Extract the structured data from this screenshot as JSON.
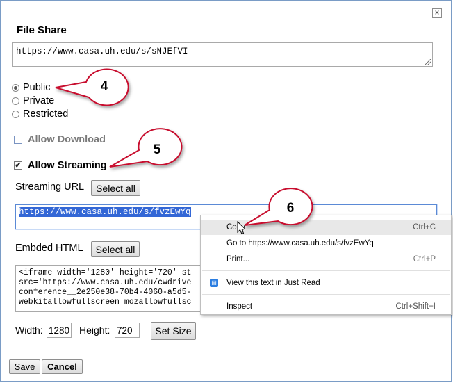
{
  "dialog": {
    "title": "File Share",
    "close_glyph": "×",
    "share_url": "https://www.casa.uh.edu/s/sNJEfVI"
  },
  "access": {
    "options": [
      {
        "label": "Public",
        "checked": true
      },
      {
        "label": "Private",
        "checked": false
      },
      {
        "label": "Restricted",
        "checked": false
      }
    ]
  },
  "permissions": {
    "allow_download": {
      "label": "Allow Download",
      "checked": false
    },
    "allow_streaming": {
      "label": "Allow Streaming",
      "checked": true
    }
  },
  "streaming": {
    "label": "Streaming URL",
    "select_all": "Select all",
    "url": "https://www.casa.uh.edu/s/fvzEwYq"
  },
  "embed": {
    "label": "Embded HTML",
    "select_all": "Select all",
    "code": "<iframe width='1280' height='720' st\nsrc='https://www.casa.uh.edu/cwdrive\nconference__2e250e38-70b4-4060-a5d5-\nwebkitallowfullscreen mozallowfullsc"
  },
  "size": {
    "width_label": "Width:",
    "width_value": "1280",
    "height_label": "Height:",
    "height_value": "720",
    "set_size": "Set Size"
  },
  "footer": {
    "save": "Save",
    "cancel": "Cancel"
  },
  "context_menu": {
    "copy": {
      "label": "Copy",
      "shortcut": "Ctrl+C"
    },
    "go_to": {
      "label": "Go to https://www.casa.uh.edu/s/fvzEwYq"
    },
    "print": {
      "label": "Print...",
      "shortcut": "Ctrl+P"
    },
    "just_read": {
      "label": "View this text in Just Read",
      "icon": "book-icon"
    },
    "inspect": {
      "label": "Inspect",
      "shortcut": "Ctrl+Shift+I"
    }
  },
  "callouts": {
    "step4": "4",
    "step5": "5",
    "step6": "6",
    "color_stroke": "#c8102e"
  }
}
